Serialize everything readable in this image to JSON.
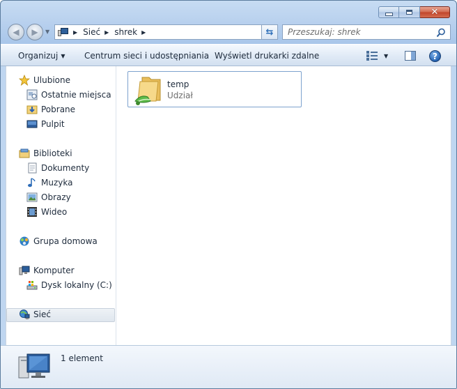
{
  "window": {
    "minimize_icon": "minimize-icon",
    "maximize_icon": "maximize-icon",
    "close_icon": "close-icon"
  },
  "address_bar": {
    "breadcrumbs": [
      "Sieć",
      "shrek"
    ],
    "location_icon": "network-computer-icon"
  },
  "search": {
    "placeholder": "Przeszukaj: shrek"
  },
  "toolbar": {
    "organize_label": "Organizuj",
    "network_center_label": "Centrum sieci i udostępniania",
    "remote_printers_label": "Wyświetl drukarki zdalne"
  },
  "sidebar": {
    "favorites": {
      "label": "Ulubione",
      "items": [
        "Ostatnie miejsca",
        "Pobrane",
        "Pulpit"
      ]
    },
    "libraries": {
      "label": "Biblioteki",
      "items": [
        "Dokumenty",
        "Muzyka",
        "Obrazy",
        "Wideo"
      ]
    },
    "homegroup": {
      "label": "Grupa domowa"
    },
    "computer": {
      "label": "Komputer",
      "items": [
        "Dysk lokalny (C:)"
      ]
    },
    "network": {
      "label": "Sieć",
      "selected": true
    }
  },
  "files": [
    {
      "name": "temp",
      "type": "Udział",
      "icon": "shared-folder-icon"
    }
  ],
  "details": {
    "count_text": "1 element"
  },
  "colors": {
    "chrome": "#b9d1ee",
    "command_bar": "#e0eaf6",
    "selection_border": "#7da2ce",
    "close_button": "#c1452a"
  }
}
